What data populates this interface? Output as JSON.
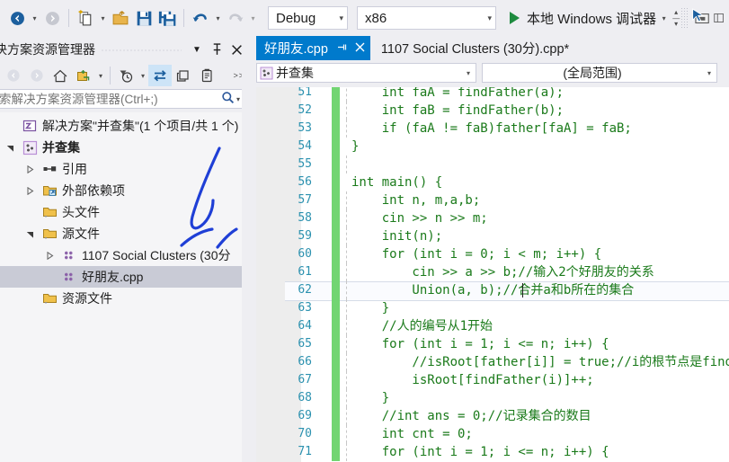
{
  "toolbar": {
    "nav_back_title": "后退",
    "nav_forward_title": "前进",
    "new_item_title": "添加新项",
    "open_title": "打开文件",
    "save_title": "保存",
    "save_all_title": "全部保存",
    "undo_title": "撤消",
    "redo_title": "恢复",
    "config_value": "Debug",
    "platform_value": "x86",
    "run_label": "本地 Windows 调试器"
  },
  "solution_explorer": {
    "title": "决方案资源管理器",
    "dropdown_title": "窗口选项",
    "pin_title": "自动隐藏",
    "close_title": "关闭",
    "search_placeholder": "索解决方案资源管理器(Ctrl+;)",
    "search_value": "",
    "tools": {
      "back": "后退",
      "forward": "前进",
      "home": "主页",
      "new_folder": "新建文件夹",
      "pending_changes": "挂起的更改筛选器",
      "sync": "与活动文档同步",
      "refresh": "刷新",
      "show_all_files": "显示所有文件"
    },
    "root": "解决方案\"并查集\"(1 个项目/共 1 个)",
    "items": [
      {
        "label": "并查集",
        "indent": 1,
        "expander": "down",
        "icon": "cpp-project-icon",
        "bold": true,
        "selected": false
      },
      {
        "label": "引用",
        "indent": 2,
        "expander": "right",
        "icon": "references-icon",
        "bold": false,
        "selected": false
      },
      {
        "label": "外部依赖项",
        "indent": 2,
        "expander": "right",
        "icon": "folder-ext-icon",
        "bold": false,
        "selected": false
      },
      {
        "label": "头文件",
        "indent": 2,
        "expander": "none",
        "icon": "folder-icon",
        "bold": false,
        "selected": false
      },
      {
        "label": "源文件",
        "indent": 2,
        "expander": "down",
        "icon": "folder-icon",
        "bold": false,
        "selected": false
      },
      {
        "label": "1107 Social Clusters (30分",
        "indent": 3,
        "expander": "right",
        "icon": "cpp-file-icon",
        "bold": false,
        "selected": false
      },
      {
        "label": "好朋友.cpp",
        "indent": 3,
        "expander": "none",
        "icon": "cpp-file-icon",
        "bold": false,
        "selected": true
      },
      {
        "label": "资源文件",
        "indent": 2,
        "expander": "none",
        "icon": "folder-icon",
        "bold": false,
        "selected": false
      }
    ]
  },
  "tabs": [
    {
      "label": "好朋友.cpp",
      "active": true,
      "pin": "⊣",
      "close": "✕"
    },
    {
      "label": "1107 Social Clusters (30分).cpp*",
      "active": false
    }
  ],
  "navbar": {
    "project": "并查集",
    "scope": "(全局范围)"
  },
  "editor": {
    "lines": [
      {
        "num": "51",
        "text": "    int faA = findFather(a);",
        "changed": true,
        "current": false,
        "indent_guide": true
      },
      {
        "num": "52",
        "text": "    int faB = findFather(b);",
        "changed": true,
        "current": false,
        "indent_guide": true
      },
      {
        "num": "53",
        "text": "    if (faA != faB)father[faA] = faB;",
        "changed": true,
        "current": false,
        "indent_guide": true
      },
      {
        "num": "54",
        "text": "}",
        "changed": true,
        "current": false,
        "indent_guide": false
      },
      {
        "num": "55",
        "text": "",
        "changed": true,
        "current": false,
        "indent_guide": true
      },
      {
        "num": "56",
        "text": "int main() {",
        "changed": true,
        "current": false,
        "indent_guide": false
      },
      {
        "num": "57",
        "text": "    int n, m,a,b;",
        "changed": true,
        "current": false,
        "indent_guide": true
      },
      {
        "num": "58",
        "text": "    cin >> n >> m;",
        "changed": true,
        "current": false,
        "indent_guide": true
      },
      {
        "num": "59",
        "text": "    init(n);",
        "changed": true,
        "current": false,
        "indent_guide": true
      },
      {
        "num": "60",
        "text": "    for (int i = 0; i < m; i++) {",
        "changed": true,
        "current": false,
        "indent_guide": true
      },
      {
        "num": "61",
        "text": "        cin >> a >> b;//输入2个好朋友的关系",
        "changed": true,
        "current": false,
        "indent_guide": true
      },
      {
        "num": "62",
        "text": "        Union(a, b);//合并a和b所在的集合",
        "changed": true,
        "current": true,
        "indent_guide": true
      },
      {
        "num": "63",
        "text": "    }",
        "changed": true,
        "current": false,
        "indent_guide": true
      },
      {
        "num": "64",
        "text": "    //人的编号从1开始",
        "changed": true,
        "current": false,
        "indent_guide": true
      },
      {
        "num": "65",
        "text": "    for (int i = 1; i <= n; i++) {",
        "changed": true,
        "current": false,
        "indent_guide": true
      },
      {
        "num": "66",
        "text": "        //isRoot[father[i]] = true;//i的根节点是findFather(i)",
        "changed": true,
        "current": false,
        "indent_guide": true
      },
      {
        "num": "67",
        "text": "        isRoot[findFather(i)]++;",
        "changed": true,
        "current": false,
        "indent_guide": true
      },
      {
        "num": "68",
        "text": "    }",
        "changed": true,
        "current": false,
        "indent_guide": true
      },
      {
        "num": "69",
        "text": "    //int ans = 0;//记录集合的数目",
        "changed": true,
        "current": false,
        "indent_guide": true
      },
      {
        "num": "70",
        "text": "    int cnt = 0;",
        "changed": true,
        "current": false,
        "indent_guide": true
      },
      {
        "num": "71",
        "text": "    for (int i = 1; i <= n; i++) {",
        "changed": true,
        "current": false,
        "indent_guide": true
      }
    ],
    "caret_line": "62",
    "colors": {
      "code_text": "#1A7A1A",
      "line_number": "#2B91AF",
      "change_bar": "#72D572",
      "gutter_bg": "#EDEDED"
    }
  },
  "theme": {
    "accent": "#007ACC",
    "chrome_bg": "#EEEEF2",
    "panel_bg": "#F5F5F7",
    "selection_bg": "#C9CBD6",
    "annotation_ink": "#1F3FD6"
  }
}
